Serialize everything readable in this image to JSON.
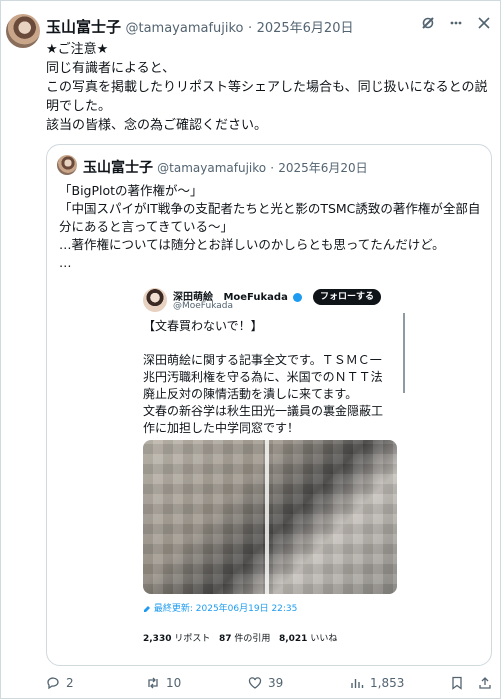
{
  "post": {
    "author_name": "玉山富士子",
    "author_handle": "@tamayamafujiko",
    "separator": "·",
    "date": "2025年6月20日",
    "body_lines": [
      "★ご注意★",
      "同じ有識者によると、",
      "この写真を掲載したりリポスト等シェアした場合も、同じ扱いになるとの説明でした。",
      "該当の皆様、念の為ご確認ください。"
    ]
  },
  "quote": {
    "author_name": "玉山富士子",
    "author_handle": "@tamayamafujiko",
    "separator": "·",
    "date": "2025年6月20日",
    "lines": [
      "「BigPlotの著作権が〜」",
      "「中国スパイがIT戦争の支配者たちと光と影のTSMC誘致の著作権が全部自分にあると言ってきている〜」",
      "…著作権については随分とお詳しいのかしらとも思ってたんだけど。",
      "…"
    ]
  },
  "embedded": {
    "author_name_jp": "深田萌絵",
    "author_name_en": "MoeFukada",
    "author_handle": "@MoeFukada",
    "follow_label": "フォローする",
    "lines": [
      "【文春買わないで！】",
      "",
      "深田萌絵に関する記事全文です。ＴＳＭＣ一兆円汚職利権を守る為に、米国でのＮＴＴ法廃止反対の陳情活動を潰しに来てます。",
      "文春の新谷学は秋生田光一議員の裏金隠蔽工作に加担した中学同窓です！"
    ],
    "updated": "最終更新: 2025年06月19日 22:35",
    "stats": {
      "reposts_count": "2,330",
      "reposts_label": "リポスト",
      "quotes_count": "87",
      "quotes_label": "件の引用",
      "likes_count": "8,021",
      "likes_label": "いいね"
    }
  },
  "actions": {
    "replies": "2",
    "reposts": "10",
    "likes": "39",
    "views": "1,853"
  },
  "icons": [
    "grok-icon",
    "more-icon",
    "x-logo-icon",
    "reply-icon",
    "repost-icon",
    "like-icon",
    "views-icon",
    "bookmark-icon",
    "share-icon"
  ]
}
